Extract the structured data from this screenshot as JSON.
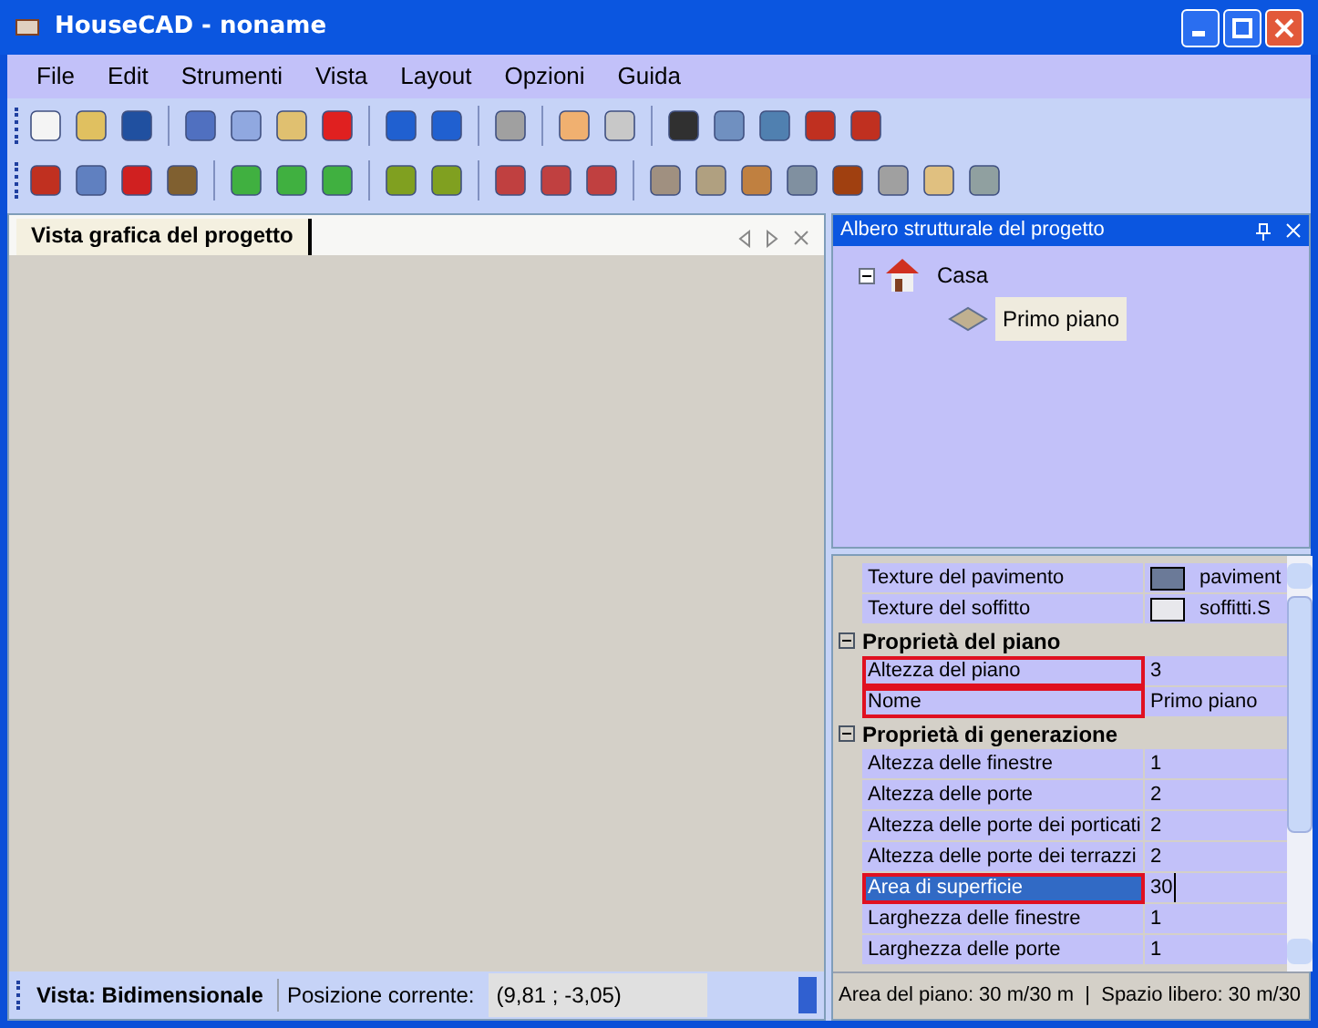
{
  "window": {
    "title": "HouseCAD - noname"
  },
  "menu": [
    "File",
    "Edit",
    "Strumenti",
    "Vista",
    "Layout",
    "Opzioni",
    "Guida"
  ],
  "graphic_view": {
    "tab": "Vista grafica del progetto",
    "tab_selected": true
  },
  "status_bar": {
    "view": "Vista: Bidimensionale",
    "position_label": "Posizione corrente:",
    "position": "(9,81 ; -3,05)"
  },
  "tree_panel": {
    "title": "Albero strutturale del progetto",
    "items": [
      {
        "label": "Casa",
        "expanded": true,
        "selected": false,
        "children": [
          {
            "label": "Primo piano",
            "selected": true
          }
        ]
      }
    ]
  },
  "properties": [
    {
      "kind": "texture",
      "name": "Texture del pavimento",
      "value": "paviment",
      "color": "#6b7a98",
      "outlined": false,
      "selected": false
    },
    {
      "kind": "texture",
      "name": "Texture del soffitto",
      "value": "soffitti.S",
      "color": "#e8e8ec",
      "outlined": false,
      "selected": false
    },
    {
      "kind": "category",
      "name": "Proprietà del piano",
      "expanded": true
    },
    {
      "kind": "value",
      "name": "Altezza del piano",
      "value": "3",
      "outlined": true,
      "selected": false
    },
    {
      "kind": "value",
      "name": "Nome",
      "value": "Primo piano",
      "outlined": true,
      "selected": false
    },
    {
      "kind": "category",
      "name": "Proprietà di generazione",
      "expanded": true
    },
    {
      "kind": "value",
      "name": "Altezza delle finestre",
      "value": "1",
      "outlined": false,
      "selected": false
    },
    {
      "kind": "value",
      "name": "Altezza delle porte",
      "value": "2",
      "outlined": false,
      "selected": false
    },
    {
      "kind": "value",
      "name": "Altezza delle porte dei porticati",
      "value": "2",
      "outlined": false,
      "selected": false
    },
    {
      "kind": "value",
      "name": "Altezza delle porte dei terrazzi",
      "value": "2",
      "outlined": false,
      "selected": false
    },
    {
      "kind": "value",
      "name": "Area di superficie",
      "value": "30",
      "outlined": true,
      "selected": true
    },
    {
      "kind": "value",
      "name": "Larghezza delle finestre",
      "value": "1",
      "outlined": false,
      "selected": false
    },
    {
      "kind": "value",
      "name": "Larghezza delle porte",
      "value": "1",
      "outlined": false,
      "selected": false
    }
  ],
  "properties_status": "Area del piano: 30 m/30 m  |  Spazio libero: 30 m/30"
}
